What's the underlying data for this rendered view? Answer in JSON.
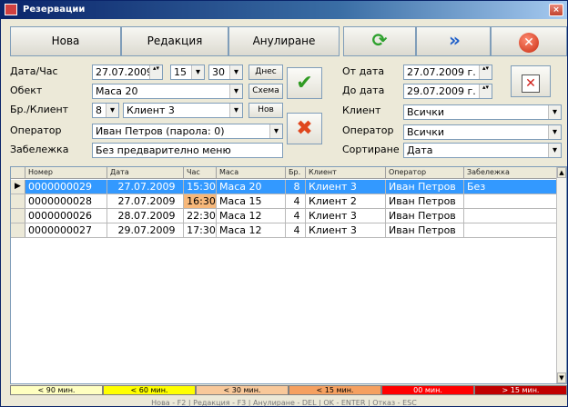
{
  "window": {
    "title": "Резервации",
    "close_glyph": "×"
  },
  "toolbar": {
    "new_label": "Нова",
    "edit_label": "Редакция",
    "cancel_label": "Анулиране",
    "refresh_icon": "refresh-icon",
    "forward_icon": "forward-icon",
    "exit_icon": "exit-icon"
  },
  "form": {
    "date_time_label": "Дата/Час",
    "date_value": "27.07.2009 г.",
    "hour_value": "15",
    "minute_value": "30",
    "today_button": "Днес",
    "object_label": "Обект",
    "object_value": "Маса 20",
    "schema_button": "Схема",
    "count_client_label": "Бр./Клиент",
    "count_value": "8",
    "client_value": "Клиент 3",
    "new_client_button": "Нов",
    "operator_label": "Оператор",
    "operator_value": "Иван Петров (парола: 0)",
    "note_label": "Забележка",
    "note_value": "Без предварително меню"
  },
  "filter": {
    "from_date_label": "От дата",
    "from_date_value": "27.07.2009 г.",
    "to_date_label": "До дата",
    "to_date_value": "29.07.2009 г.",
    "client_label": "Клиент",
    "client_value": "Всички",
    "operator_label": "Оператор",
    "operator_value": "Всички",
    "sort_label": "Сортиране",
    "sort_value": "Дата"
  },
  "grid": {
    "columns": [
      "Номер",
      "Дата",
      "Час",
      "Маса",
      "Бр.",
      "Клиент",
      "Оператор",
      "Забележка"
    ],
    "rows": [
      {
        "number": "0000000029",
        "date": "27.07.2009",
        "time": "15:30",
        "table": "Маса 20",
        "count": "8",
        "client": "Клиент 3",
        "operator": "Иван Петров",
        "note": "Без"
      },
      {
        "number": "0000000028",
        "date": "27.07.2009",
        "time": "16:30",
        "table": "Маса 15",
        "count": "4",
        "client": "Клиент 2",
        "operator": "Иван Петров",
        "note": ""
      },
      {
        "number": "0000000026",
        "date": "28.07.2009",
        "time": "22:30",
        "table": "Маса 12",
        "count": "4",
        "client": "Клиент 3",
        "operator": "Иван Петров",
        "note": ""
      },
      {
        "number": "0000000027",
        "date": "29.07.2009",
        "time": "17:30",
        "table": "Маса 12",
        "count": "4",
        "client": "Клиент 3",
        "operator": "Иван Петров",
        "note": ""
      }
    ],
    "row_indicator": "▶"
  },
  "legend": [
    {
      "label": "< 90 мин.",
      "color": "#ffffc0",
      "text_color": "#000000"
    },
    {
      "label": "< 60 мин.",
      "color": "#ffff00",
      "text_color": "#000000"
    },
    {
      "label": "< 30 мин.",
      "color": "#f8c89a",
      "text_color": "#000000"
    },
    {
      "label": "< 15 мин.",
      "color": "#f5a060",
      "text_color": "#000000"
    },
    {
      "label": "00 мин.",
      "color": "#ff0000",
      "text_color": "#ffffff"
    },
    {
      "label": "> 15 мин.",
      "color": "#c00000",
      "text_color": "#ffffff"
    }
  ],
  "status_text": "Нова - F2 | Редакция - F3 | Анулиране - DEL | OK - ENTER | Отказ - ESC"
}
